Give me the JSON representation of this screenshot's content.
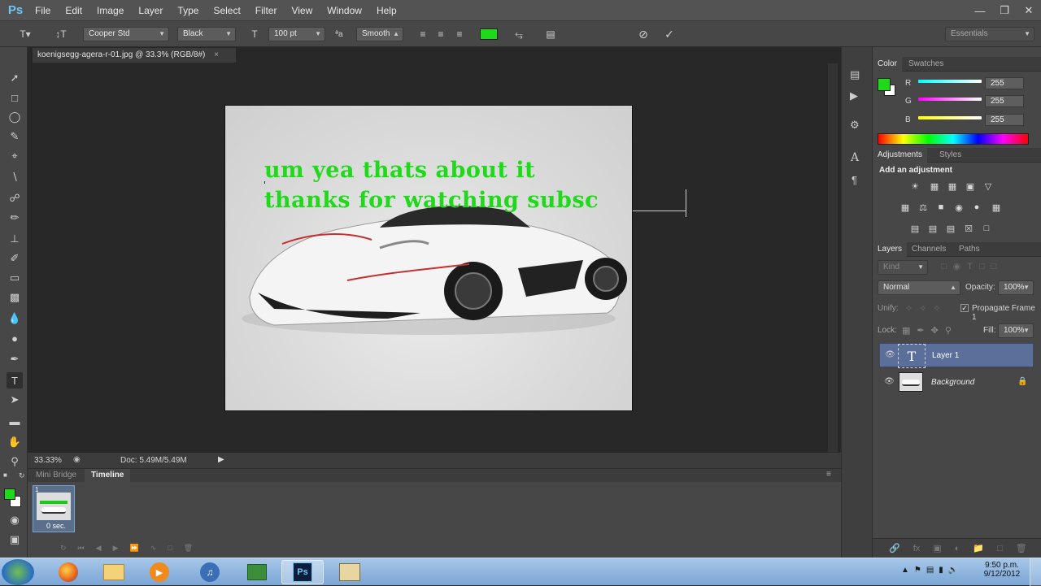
{
  "app": {
    "logo": "Ps"
  },
  "menu": [
    "File",
    "Edit",
    "Image",
    "Layer",
    "Type",
    "Select",
    "Filter",
    "View",
    "Window",
    "Help"
  ],
  "options": {
    "font_family": "Cooper Std",
    "font_style": "Black",
    "font_size": "100 pt",
    "antialias": "Smooth",
    "text_color": "#1fd91a",
    "workspace": "Essentials"
  },
  "document": {
    "tab_title": "koenigsegg-agera-r-01.jpg @ 33.3% (RGB/8#)",
    "text_line1": "um yea thats about it",
    "text_line2": "thanks for watching subsc",
    "zoom": "33.33%",
    "doc_info": "Doc: 5.49M/5.49M"
  },
  "bottom_panel": {
    "tabs": [
      "Mini Bridge",
      "Timeline"
    ],
    "frame_number": "1",
    "frame_delay": "0 sec."
  },
  "color_panel": {
    "tabs": [
      "Color",
      "Swatches"
    ],
    "r_label": "R",
    "g_label": "G",
    "b_label": "B",
    "r": "255",
    "g": "255",
    "b": "255",
    "foreground": "#1fd91a"
  },
  "adjustments": {
    "tabs": [
      "Adjustments",
      "Styles"
    ],
    "heading": "Add an adjustment"
  },
  "layers": {
    "tabs": [
      "Layers",
      "Channels",
      "Paths"
    ],
    "kind": "Kind",
    "blend_mode": "Normal",
    "opacity_label": "Opacity:",
    "opacity": "100%",
    "unify_label": "Unify:",
    "propagate_label": "Propagate Frame 1",
    "lock_label": "Lock:",
    "fill_label": "Fill:",
    "fill": "100%",
    "items": [
      {
        "name": "Layer 1"
      },
      {
        "name": "Background"
      }
    ]
  },
  "taskbar": {
    "time": "9:50 p.m.",
    "date": "9/12/2012"
  }
}
